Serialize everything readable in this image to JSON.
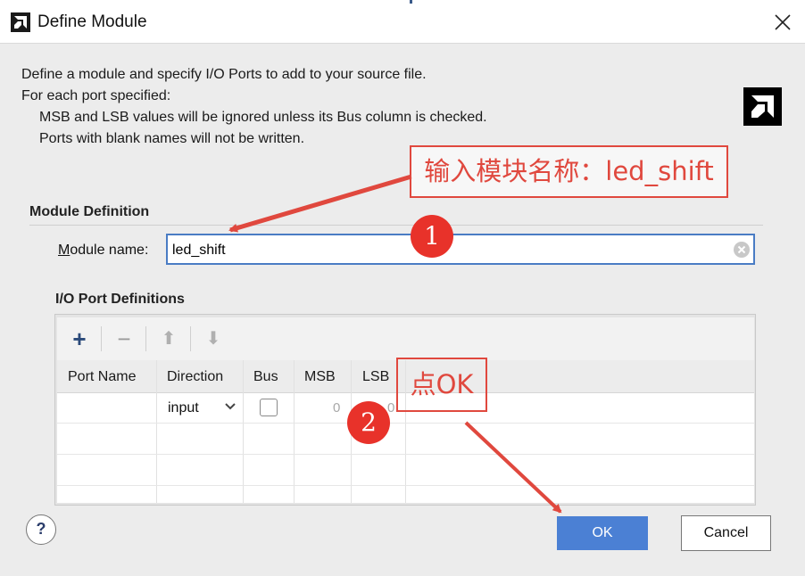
{
  "window": {
    "title": "Define Module",
    "close_icon": "close-icon",
    "app_icon": "amd-logo-icon"
  },
  "description": {
    "line1": "Define a module and specify I/O Ports to add to your source file.",
    "line2": "For each port specified:",
    "line3": "MSB and LSB values will be ignored unless its Bus column is checked.",
    "line4": "Ports with blank names will not be written."
  },
  "module_definition": {
    "section_title": "Module Definition",
    "name_label_prefix": "M",
    "name_label_rest": "odule name:",
    "name_value": "led_shift"
  },
  "io_ports": {
    "section_title": "I/O Port Definitions",
    "toolbar": {
      "add": "+",
      "remove": "−",
      "move_up": "⬆",
      "move_down": "⬇"
    },
    "columns": [
      "Port Name",
      "Direction",
      "Bus",
      "MSB",
      "LSB"
    ],
    "rows": [
      {
        "port_name": "",
        "direction": "input",
        "bus": false,
        "msb": "0",
        "lsb": "0"
      }
    ]
  },
  "buttons": {
    "help": "?",
    "ok": "OK",
    "cancel": "Cancel"
  },
  "annotations": {
    "callout1": "输入模块名称：led_shift",
    "callout2": "点OK",
    "badge1": "1",
    "badge2": "2",
    "color": "#e0483e"
  },
  "colors": {
    "accent": "#4b80d4",
    "input_border": "#4a7cc4"
  }
}
